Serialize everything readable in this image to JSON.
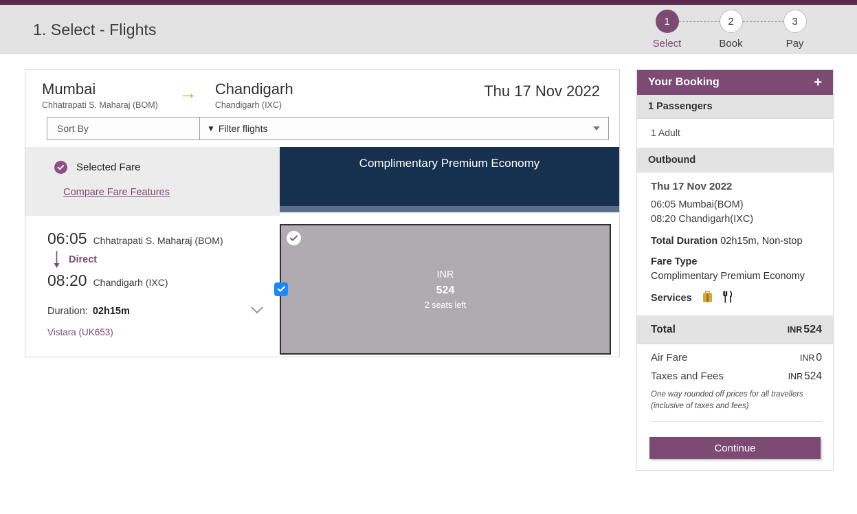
{
  "header": {
    "page_title": "1. Select - Flights",
    "steps": [
      {
        "num": "1",
        "label": "Select",
        "active": true
      },
      {
        "num": "2",
        "label": "Book",
        "active": false
      },
      {
        "num": "3",
        "label": "Pay",
        "active": false
      }
    ]
  },
  "route": {
    "origin_city": "Mumbai",
    "origin_airport": "Chhatrapati S. Maharaj (BOM)",
    "arrow": "→",
    "dest_city": "Chandigarh",
    "dest_airport": "Chandigarh (IXC)",
    "date": "Thu 17 Nov 2022"
  },
  "controls": {
    "sort_by_placeholder": "Sort By",
    "sort_by_value": "",
    "filter_label": "Filter flights"
  },
  "fare_band": {
    "selected_fare_label": "Selected Fare",
    "compare_link": "Compare Fare Features",
    "fare_name": "Complimentary Premium Economy"
  },
  "flight": {
    "depart_time": "06:05",
    "depart_airport": "Chhatrapati S. Maharaj (BOM)",
    "stops_label": "Direct",
    "arrive_time": "08:20",
    "arrive_airport": "Chandigarh (IXC)",
    "duration_label": "Duration:",
    "duration_value": "02h15m",
    "airline": "Vistara (UK653)",
    "fare_currency": "INR",
    "fare_amount": "524",
    "seats_left": "2 seats left"
  },
  "sidebar": {
    "title": "Your Booking",
    "passengers_head": "1 Passengers",
    "passengers_detail": "1 Adult",
    "outbound_head": "Outbound",
    "outbound_date": "Thu 17 Nov 2022",
    "leg_depart": "06:05 Mumbai(BOM)",
    "leg_arrive": "08:20 Chandigarh(IXC)",
    "total_duration_label": "Total Duration",
    "total_duration_value": "02h15m, Non-stop",
    "fare_type_label": "Fare Type",
    "fare_type_value": "Complimentary Premium Economy",
    "services_label": "Services",
    "total_label": "Total",
    "total_currency": "INR",
    "total_value": "524",
    "air_fare_label": "Air Fare",
    "air_fare_currency": "INR",
    "air_fare_value": "0",
    "taxes_label": "Taxes and Fees",
    "taxes_currency": "INR",
    "taxes_value": "524",
    "note": "One way rounded off prices for all travellers (inclusive of taxes and fees)",
    "continue_label": "Continue"
  },
  "colors": {
    "plum_strip": "#5c2a4f",
    "purple": "#7d4a74",
    "navy": "#16304f",
    "slate": "#5a6d8c",
    "gold": "#d9a431",
    "fare_cell": "#b0aab1",
    "checkbox_blue": "#1a88ff"
  }
}
